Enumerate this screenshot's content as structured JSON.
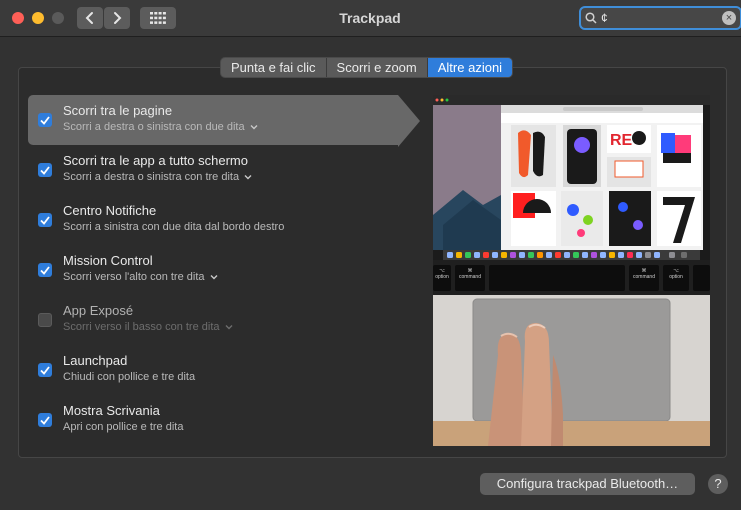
{
  "window": {
    "title": "Trackpad",
    "search_value": "¢"
  },
  "tabs": [
    {
      "label": "Punta e fai clic",
      "active": false
    },
    {
      "label": "Scorri e zoom",
      "active": false
    },
    {
      "label": "Altre azioni",
      "active": true
    }
  ],
  "options": [
    {
      "title": "Scorri tra le pagine",
      "subtitle": "Scorri a destra o sinistra con due dita",
      "checked": true,
      "dropdown": true,
      "selected": true,
      "disabled": false
    },
    {
      "title": "Scorri tra le app a tutto schermo",
      "subtitle": "Scorri a destra o sinistra con tre dita",
      "checked": true,
      "dropdown": true,
      "selected": false,
      "disabled": false
    },
    {
      "title": "Centro Notifiche",
      "subtitle": "Scorri a sinistra con due dita dal bordo destro",
      "checked": true,
      "dropdown": false,
      "selected": false,
      "disabled": false
    },
    {
      "title": "Mission Control",
      "subtitle": "Scorri verso l'alto con tre dita",
      "checked": true,
      "dropdown": true,
      "selected": false,
      "disabled": false
    },
    {
      "title": "App Exposé",
      "subtitle": "Scorri verso il basso con tre dita",
      "checked": false,
      "dropdown": true,
      "selected": false,
      "disabled": true
    },
    {
      "title": "Launchpad",
      "subtitle": "Chiudi con pollice e tre dita",
      "checked": true,
      "dropdown": false,
      "selected": false,
      "disabled": false
    },
    {
      "title": "Mostra Scrivania",
      "subtitle": "Apri con pollice e tre dita",
      "checked": true,
      "dropdown": false,
      "selected": false,
      "disabled": false
    }
  ],
  "preview": {
    "key_labels": [
      "command",
      "command",
      "option",
      "option"
    ],
    "key_symbols": [
      "⌘",
      "⌘",
      "⌥",
      "⌥"
    ]
  },
  "footer": {
    "bluetooth_button": "Configura trackpad Bluetooth…",
    "help_label": "?"
  },
  "colors": {
    "accent": "#2f7ddb",
    "window_bg": "#323232",
    "close": "#fe5f57",
    "minimize": "#febc2e"
  }
}
